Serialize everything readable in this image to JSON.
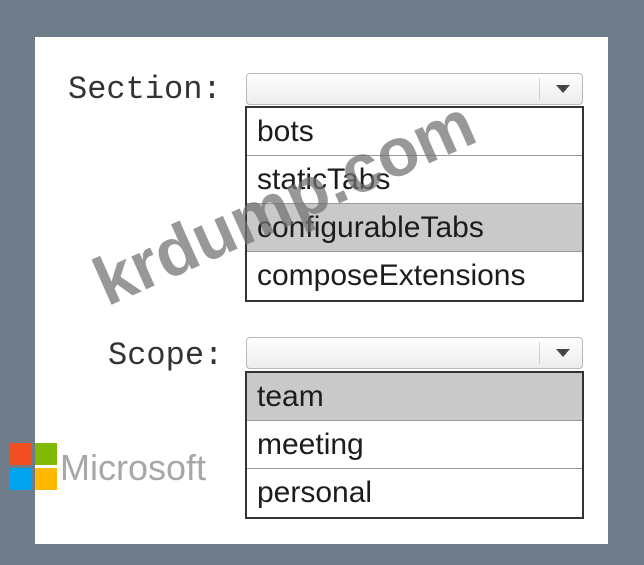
{
  "section": {
    "label": "Section:",
    "selected_value": "",
    "options": [
      "bots",
      "staticTabs",
      "configurableTabs",
      "composeExtensions"
    ],
    "highlighted": "configurableTabs"
  },
  "scope": {
    "label": "Scope:",
    "selected_value": "",
    "options": [
      "team",
      "meeting",
      "personal"
    ],
    "highlighted": "team"
  },
  "watermark": "krdump.com",
  "brand": {
    "name": "Microsoft",
    "logo_colors": [
      "#f25022",
      "#7fba00",
      "#00a4ef",
      "#ffb900"
    ]
  },
  "icons": {
    "dropdown": "chevron-down-icon",
    "logo": "microsoft-logo-icon"
  }
}
